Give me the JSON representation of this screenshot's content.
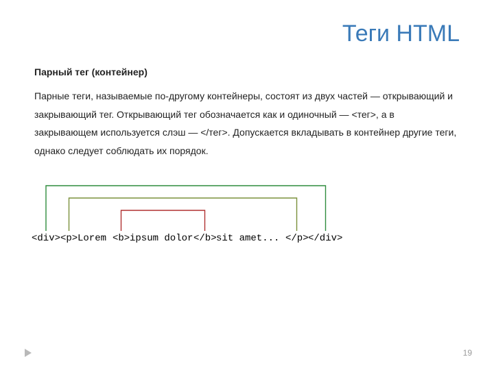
{
  "title": "Теги HTML",
  "subhead": "Парный тег (контейнер)",
  "body": "Парные теги, называемые по-другому контейнеры, состоят из двух частей — открывающий и закрывающий тег. Открывающий тег обозначается как и одиночный — <тег>, а в закрывающем используется слэш — </тег>. Допускается вкладывать в контейнер другие теги, однако следует соблюдать их порядок.",
  "code": {
    "t1": "<div>",
    "t2": "<p>",
    "txt1": "Lorem ",
    "t3": "<b>",
    "txt2": "ipsum dolor",
    "t4": "</b>",
    "txt3": " sit amet...",
    "t5": "</p>",
    "t6": "</div>"
  },
  "pageNumber": "19",
  "colors": {
    "outerBracket": "#2e8b3d",
    "middleBracket": "#7a903a",
    "innerBracket": "#b03030",
    "tag": "#1a3cc9"
  }
}
